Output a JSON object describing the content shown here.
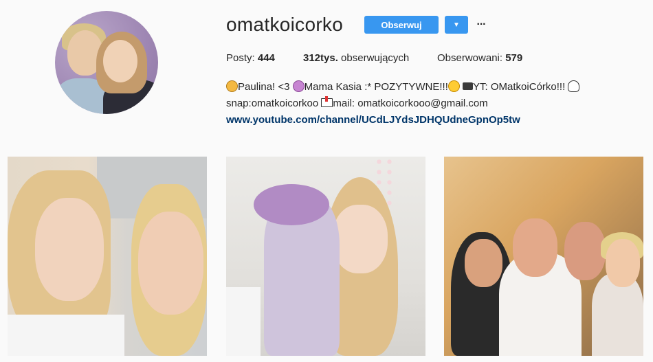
{
  "profile": {
    "username": "omatkoicorko",
    "follow_label": "Obserwuj",
    "more_label": "···"
  },
  "stats": {
    "posts_label": "Posty: ",
    "posts_value": "444",
    "followers_value": "312tys.",
    "followers_label": " obserwujących",
    "following_label": "Obserwowani: ",
    "following_value": "579"
  },
  "bio": {
    "line1_a": "Paulina! <3 ",
    "line1_b": "Mama Kasia :* POZYTYWNE!!!",
    "line1_c": "YT: OMatkoiCórko!!! ",
    "line2_a": "snap:omatkoicorkoo ",
    "line2_b": "mail: omatkoicorkooo@gmail.com",
    "link": "www.youtube.com/channel/UCdLJYdsJDHQUdneGpnOp5tw"
  },
  "icons": {
    "dropdown": "chevron-down-icon",
    "more": "ellipsis-icon"
  },
  "colors": {
    "accent": "#3897f0",
    "link": "#003569",
    "text": "#262626",
    "background": "#fafafa"
  }
}
